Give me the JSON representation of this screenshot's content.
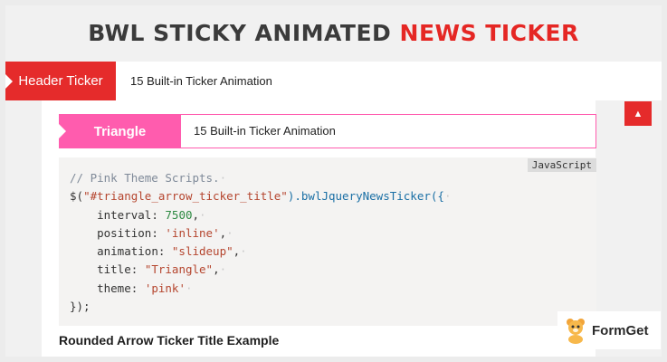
{
  "title": {
    "part1": "BWL STICKY ANIMATED",
    "part2": "NEWS TICKER"
  },
  "header_ticker": {
    "label": "Header Ticker",
    "text": "15 Built-in Ticker Animation"
  },
  "triangle_ticker": {
    "label": "Triangle",
    "text": "15 Built-in Ticker Animation"
  },
  "code": {
    "language": "JavaScript",
    "comment": "// Pink Theme Scripts.",
    "selector_prefix": "$(",
    "selector": "\"#triangle_arrow_ticker_title\"",
    "call_rest": ").bwlJqueryNewsTicker({",
    "props": [
      {
        "key": "interval",
        "value": "7500",
        "kind": "num"
      },
      {
        "key": "position",
        "value": "'inline'",
        "kind": "str"
      },
      {
        "key": "animation",
        "value": "\"slideup\"",
        "kind": "str"
      },
      {
        "key": "title",
        "value": "\"Triangle\"",
        "kind": "str"
      },
      {
        "key": "theme",
        "value": "'pink'",
        "kind": "str"
      }
    ],
    "closing": "});"
  },
  "section_heading": "Rounded Arrow Ticker Title Example",
  "brand": {
    "name": "FormGet"
  },
  "colors": {
    "accent_red": "#e52b2b",
    "pink": "#ff5cae"
  }
}
